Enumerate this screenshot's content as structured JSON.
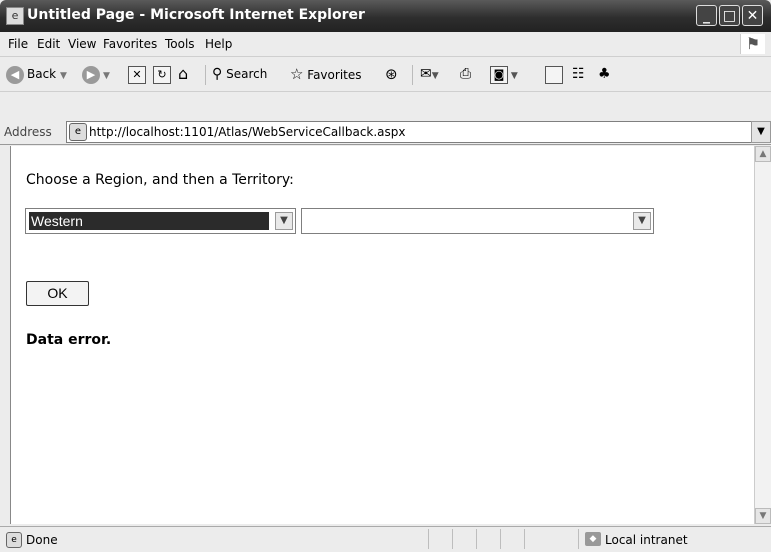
{
  "window": {
    "title": "Untitled Page - Microsoft Internet Explorer",
    "minimize_glyph": "_",
    "maximize_glyph": "□",
    "close_glyph": "✕"
  },
  "menu": {
    "items": [
      "File",
      "Edit",
      "View",
      "Favorites",
      "Tools",
      "Help"
    ]
  },
  "toolbar": {
    "back_label": "Back",
    "search_label": "Search",
    "favorites_label": "Favorites"
  },
  "address": {
    "label": "Address",
    "url": "http://localhost:1101/Atlas/WebServiceCallback.aspx"
  },
  "page": {
    "prompt": "Choose a Region, and then a Territory:",
    "region_select_value": "Western",
    "territory_select_value": "",
    "ok_button_label": "OK",
    "error_message": "Data error."
  },
  "status": {
    "text": "Done",
    "zone": "Local intranet"
  }
}
